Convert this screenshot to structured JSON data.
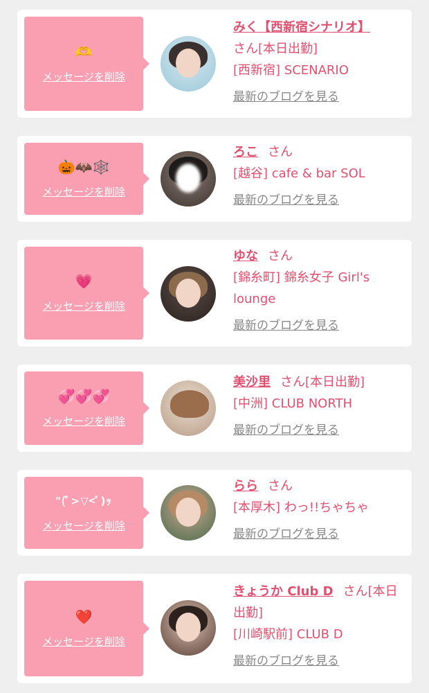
{
  "delete_label": "メッセージを削除",
  "blog_label": "最新のブログを見る",
  "san_label": "さん",
  "colors": {
    "page_bg": "#efefef",
    "card_bg": "#ffffff",
    "bubble_bg": "#fa9fb1",
    "accent": "#e2506f",
    "link_gray": "#888888"
  },
  "messages": [
    {
      "emoji": "🫶",
      "name": "みく【西新宿シナリオ】",
      "status": "[本日出勤]",
      "shop": "[西新宿] SCENARIO"
    },
    {
      "emoji": "🎃🦇🕸️",
      "name": "ろこ",
      "status": "",
      "shop": "[越谷] cafe & bar SOL"
    },
    {
      "emoji": "💗",
      "name": "ゆな",
      "status": "",
      "shop": "[錦糸町] 錦糸女子 Girl's lounge"
    },
    {
      "emoji": "💞💞💞",
      "name": "美沙里",
      "status": "[本日出勤]",
      "shop": "[中洲] CLUB NORTH"
    },
    {
      "emoji": "\"(ﾟ>▽<ﾟ)ｯ",
      "name": "らら",
      "status": "",
      "shop": "[本厚木] わっ!!ちゃちゃ"
    },
    {
      "emoji": "❤️",
      "name": "きょうか Club D",
      "status": "[本日出勤]",
      "shop": "[川崎駅前] CLUB D"
    }
  ]
}
